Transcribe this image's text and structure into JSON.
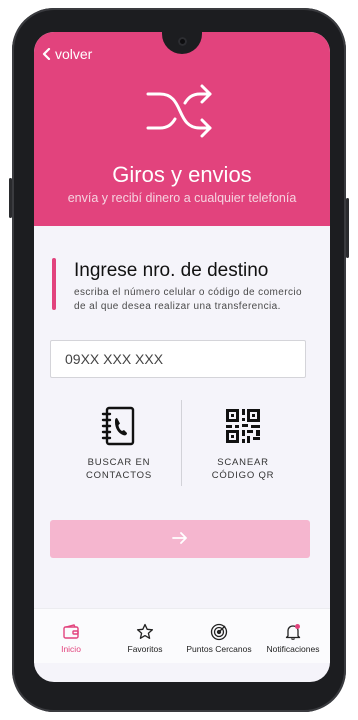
{
  "header": {
    "back_label": "volver",
    "title": "Giros y envios",
    "subtitle": "envía y recibí  dinero a cualquier telefonía",
    "color": "#e2437d"
  },
  "form": {
    "heading": "Ingrese nro. de destino",
    "description": "escriba el número celular o código de comercio de al que desea realizar una transferencia.",
    "phone_placeholder": "09XX XXX XXX",
    "phone_value": ""
  },
  "options": [
    {
      "icon": "contacts-book-icon",
      "line1": "BUSCAR EN",
      "line2": "CONTACTOS"
    },
    {
      "icon": "qr-code-icon",
      "line1": "SCANEAR",
      "line2": "CÓDIGO QR"
    }
  ],
  "next_button": {
    "icon": "arrow-right-icon",
    "color": "#f5b6cf"
  },
  "tabs": [
    {
      "label": "Inicio",
      "icon": "wallet-icon",
      "active": true
    },
    {
      "label": "Favoritos",
      "icon": "star-icon",
      "active": false
    },
    {
      "label": "Puntos Cercanos",
      "icon": "target-icon",
      "active": false
    },
    {
      "label": "Notificaciones",
      "icon": "bell-icon",
      "active": false
    }
  ]
}
